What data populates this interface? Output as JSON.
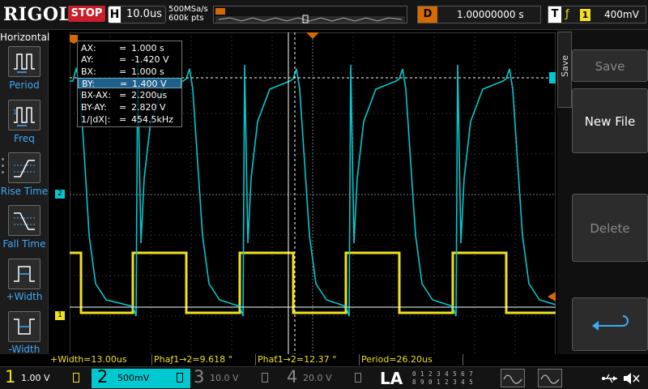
{
  "header": {
    "logo": "RIGOL",
    "run_state": "STOP",
    "timebase_label": "H",
    "timebase": "10.0us",
    "sample_rate": "500MSa/s",
    "memory_depth": "600k pts",
    "delay_label": "D",
    "delay": "1.00000000 s",
    "trigger_label": "T",
    "trigger_edge": "ƒ",
    "trigger_source": "1",
    "trigger_level": "400mV"
  },
  "left_menu": {
    "title": "Horizontal",
    "items": [
      {
        "label": "Period",
        "icon": "period-icon"
      },
      {
        "label": "Freq",
        "icon": "frequency-icon"
      },
      {
        "label": "Rise Time",
        "icon": "rise-time-icon"
      },
      {
        "label": "Fall Time",
        "icon": "fall-time-icon"
      },
      {
        "label": "+Width",
        "icon": "positive-width-icon"
      },
      {
        "label": "-Width",
        "icon": "negative-width-icon"
      }
    ]
  },
  "cursor": {
    "rows": [
      {
        "key": "AX:",
        "eq": "=",
        "value": "1.000 s"
      },
      {
        "key": "AY:",
        "eq": "=",
        "value": "-1.420 V"
      },
      {
        "key": "BX:",
        "eq": "=",
        "value": "1.000 s"
      },
      {
        "key": "BY:",
        "eq": "=",
        "value": "1.400 V"
      },
      {
        "key": "BX-AX:",
        "eq": "=",
        "value": "2.200us"
      },
      {
        "key": "BY-AY:",
        "eq": "=",
        "value": "2.820 V"
      },
      {
        "key": "1/|dX|:",
        "eq": "=",
        "value": "454.5kHz"
      }
    ],
    "selected_row": 3
  },
  "channel_markers": {
    "ch1": "1",
    "ch2": "2"
  },
  "right_menu": {
    "tab": "Save",
    "buttons": [
      {
        "label": "Save",
        "enabled": false
      },
      {
        "label": "New File",
        "enabled": true
      },
      {
        "label": "Delete",
        "enabled": false
      }
    ]
  },
  "measurements": [
    "+Width=13.00us",
    "Phaƒ1→2=9.618 °",
    "Phaƭ1→2=12.37 °",
    "Period=26.20us"
  ],
  "channels": [
    {
      "num": "1",
      "scale": "1.00 V",
      "color": "#f0e020",
      "active": true
    },
    {
      "num": "2",
      "scale": "500mV",
      "color": "#00c8d0",
      "active": true
    },
    {
      "num": "3",
      "scale": "10.0 V",
      "color": "#888888",
      "active": false
    },
    {
      "num": "4",
      "scale": "20.0 V",
      "color": "#888888",
      "active": false
    }
  ],
  "la": {
    "label": "LA",
    "bits_row1": "0 1 2 3  4 5 6 7",
    "bits_row2": "8 9 0 1  2 3 4 5"
  },
  "colors": {
    "ch1": "#f0e020",
    "ch2": "#00c8d0",
    "trigger": "#d46a00",
    "accent": "#3fa9f5"
  }
}
